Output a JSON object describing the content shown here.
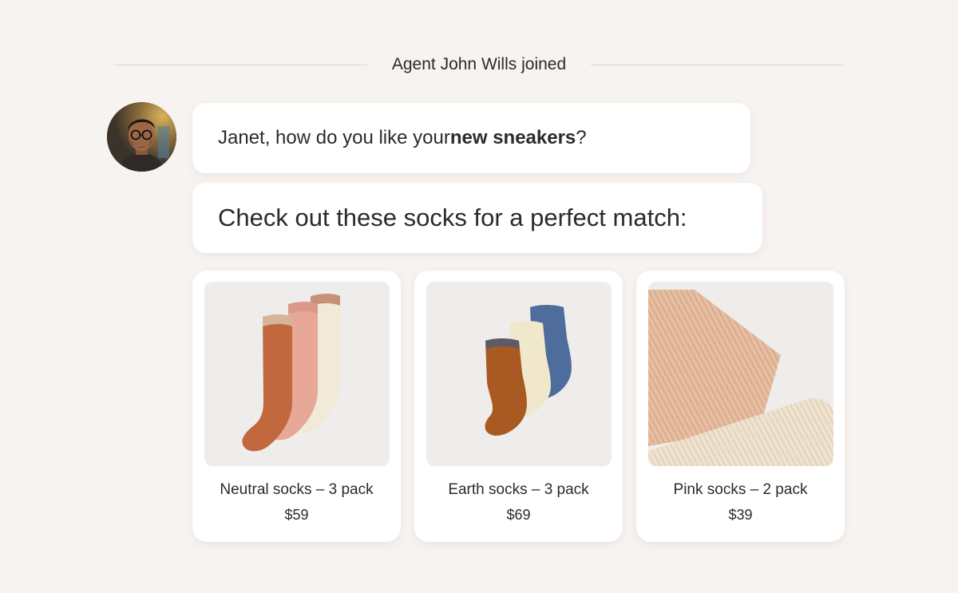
{
  "system_message": "Agent John Wills joined",
  "messages": [
    {
      "before": "Janet, how do you like your ",
      "emphasis": "new sneakers",
      "after": "?"
    },
    {
      "text": "Check out these socks for a perfect match:"
    }
  ],
  "products": [
    {
      "name": "Neutral socks – 3 pack",
      "price": "$59",
      "colors": [
        "#f2ead9",
        "#e8a898",
        "#c2683f"
      ]
    },
    {
      "name": "Earth socks – 3 pack",
      "price": "$69",
      "colors": [
        "#4f6d9c",
        "#f1e8cc",
        "#a95a22"
      ]
    },
    {
      "name": "Pink socks – 2 pack",
      "price": "$39",
      "colors": [
        "#e6bea1",
        "#efe3cf"
      ]
    }
  ],
  "colors": {
    "background": "#f7f3f0",
    "card": "#ffffff",
    "photo_background": "#efedeb",
    "text": "#2b2b2b",
    "divider": "#dcd6d1"
  }
}
